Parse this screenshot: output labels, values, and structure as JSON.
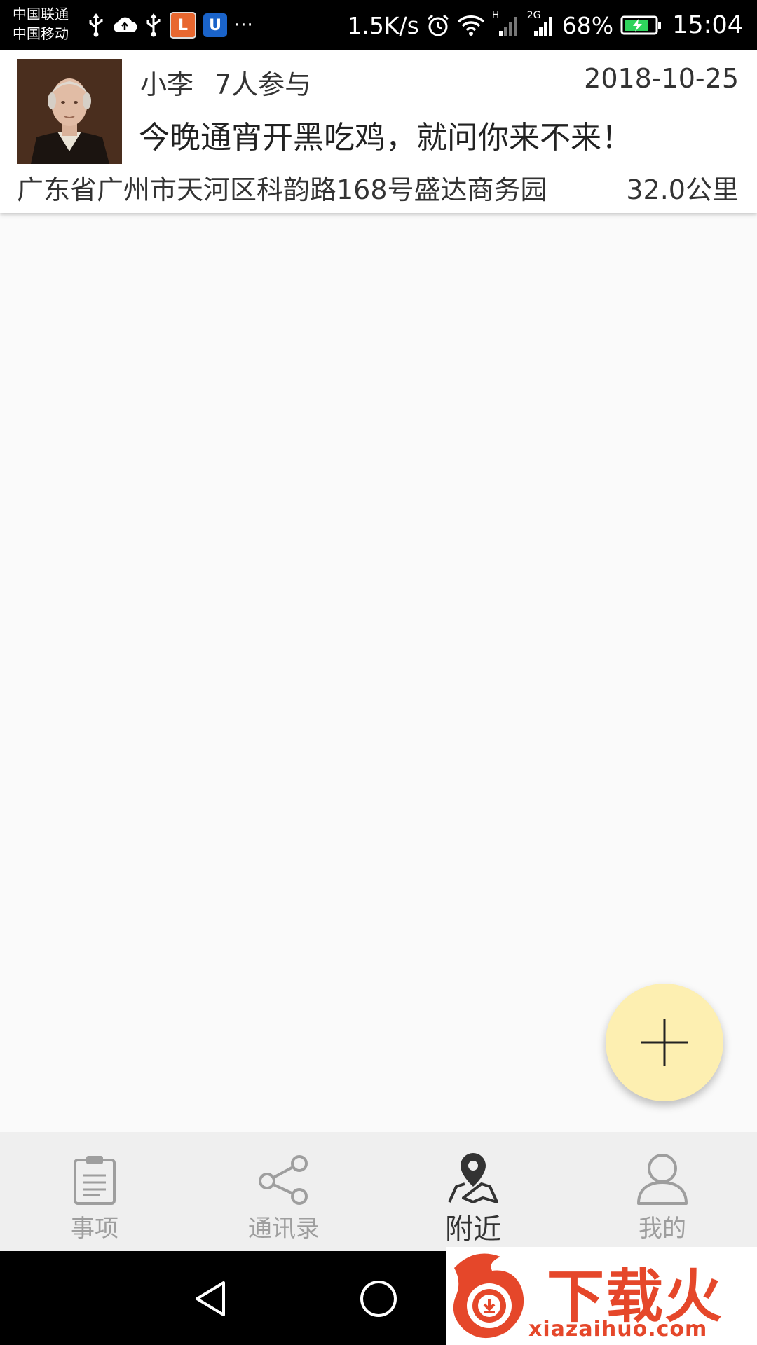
{
  "status_bar": {
    "carrier_1": "中国联通",
    "carrier_2": "中国移动",
    "network_speed": "1.5K/s",
    "signal_1_type": "H",
    "signal_2_type": "2G",
    "battery_percent": "68%",
    "time": "15:04",
    "app_badge_1": "L",
    "app_badge_2": "U",
    "more_indicator": "···",
    "icons": [
      "usb-icon",
      "cloud-upload-icon",
      "usb-icon",
      "app-notification-icon",
      "app-notification-icon",
      "alarm-icon",
      "wifi-icon",
      "signal-icon",
      "signal-icon",
      "battery-charging-icon"
    ]
  },
  "post": {
    "poster_name": "小李",
    "participants": "7人参与",
    "date": "2018-10-25",
    "title": "今晚通宵开黑吃鸡，就问你来不来！",
    "address": "广东省广州市天河区科韵路168号盛达商务园",
    "distance": "32.0公里"
  },
  "fab": {
    "icon": "plus-icon",
    "color": "#fdefb1"
  },
  "bottom_nav": {
    "tabs": [
      {
        "label": "事项",
        "icon": "clipboard-icon"
      },
      {
        "label": "通讯录",
        "icon": "share-nodes-icon"
      },
      {
        "label": "附近",
        "icon": "map-pin-icon",
        "active": true
      },
      {
        "label": "我的",
        "icon": "user-icon"
      }
    ]
  },
  "system_nav": {
    "icons": [
      "back-icon",
      "home-icon"
    ]
  },
  "watermark": {
    "brand": "下载火",
    "domain": "xiazaihuo.com",
    "color": "#e5472a"
  }
}
